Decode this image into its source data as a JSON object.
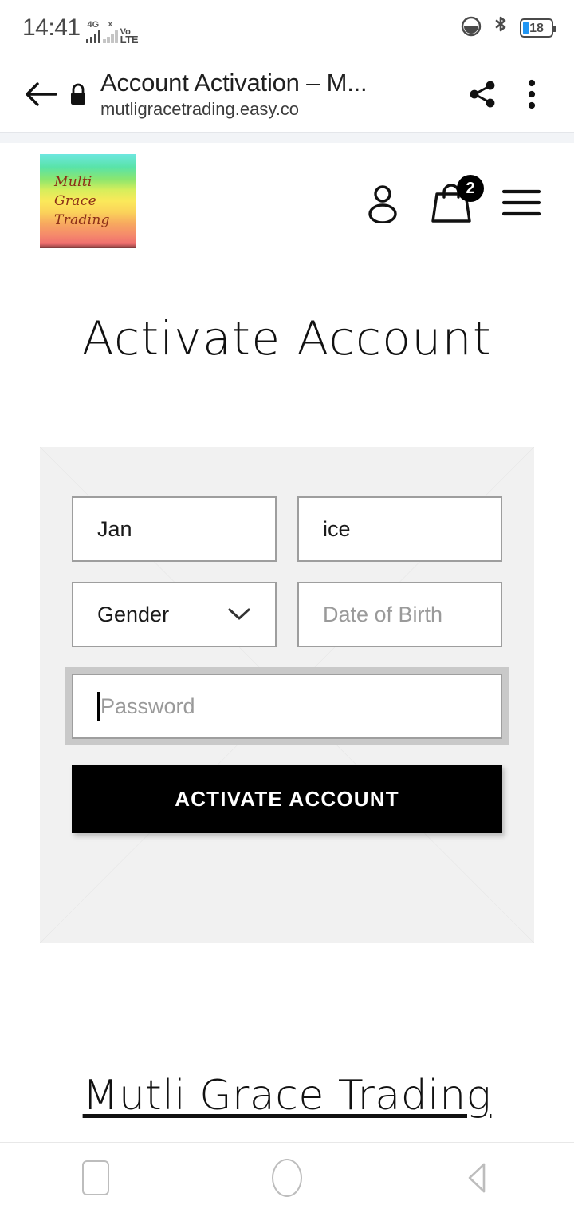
{
  "status_bar": {
    "time": "14:41",
    "network_primary": "4G",
    "network_secondary": "x",
    "volte_top": "Vo",
    "volte_bottom": "LTE",
    "dnd_icon": "do-not-disturb-icon",
    "bluetooth_icon": "bluetooth-icon",
    "battery_percent": "18"
  },
  "browser": {
    "back_icon": "back-arrow-icon",
    "lock_icon": "lock-icon",
    "page_title": "Account Activation – M...",
    "url": "mutligracetrading.easy.co",
    "share_icon": "share-icon",
    "menu_icon": "overflow-menu-icon"
  },
  "site_header": {
    "logo_lines": [
      "Multi",
      "Grace",
      "Trading"
    ],
    "account_icon": "account-person-icon",
    "cart_icon": "shopping-bag-icon",
    "cart_count": "2",
    "menu_icon": "hamburger-menu-icon"
  },
  "main": {
    "heading": "Activate Account",
    "form": {
      "first_name_value": "Jan",
      "last_name_value": "ice",
      "gender_value": "Gender",
      "gender_chevron": "chevron-down-icon",
      "date_of_birth_placeholder": "Date of Birth",
      "password_placeholder": "Password",
      "submit_label": "ACTIVATE ACCOUNT"
    }
  },
  "footer": {
    "link_label": "Mutli Grace Trading"
  },
  "android_nav": {
    "recents_icon": "recents-square-icon",
    "home_icon": "home-circle-icon",
    "back_icon": "back-triangle-icon"
  },
  "colors": {
    "button_bg": "#000000",
    "panel_bg": "#f1f1f1",
    "field_border": "#9e9e9e",
    "focus_ring": "#c9c9c9",
    "battery_fill": "#2196f3"
  }
}
